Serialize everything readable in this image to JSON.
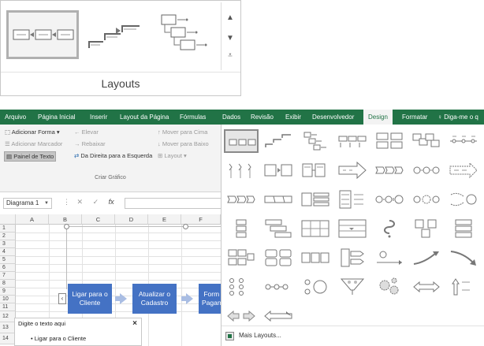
{
  "zoom_gallery": {
    "label": "Layouts",
    "scroll_up": "▲",
    "scroll_down": "▼",
    "scroll_more": "⩡"
  },
  "tabs": [
    "Arquivo",
    "Página Inicial",
    "Inserir",
    "Layout da Página",
    "Fórmulas",
    "Dados",
    "Revisão",
    "Exibir",
    "Desenvolvedor",
    "Design",
    "Formatar",
    "Diga-me o q"
  ],
  "tell_me_icon": "lightbulb-icon",
  "ribbon": {
    "add_shape": "Adicionar Forma",
    "add_bullet": "Adicionar Marcador",
    "text_pane": "Painel de Texto",
    "promote": "Elevar",
    "demote": "Rebaixar",
    "right_to_left": "Da Direita para a Esquerda",
    "move_up": "Mover para Cima",
    "move_down": "Mover para Baixo",
    "layout": "Layout",
    "group_label": "Criar Gráfico"
  },
  "formula_bar": {
    "name_box": "Diagrama 1",
    "cancel": "✕",
    "enter": "✓",
    "fx": "fx",
    "value": ""
  },
  "grid": {
    "columns": [
      "A",
      "B",
      "C",
      "D",
      "E",
      "F"
    ],
    "rows": [
      "1",
      "2",
      "3",
      "4",
      "5",
      "6",
      "7",
      "8",
      "9",
      "10",
      "11",
      "12",
      "13",
      "14"
    ]
  },
  "smartart": {
    "nodes": [
      "Ligar para o Cliente",
      "Atualizar o Cadastro",
      "Form Pagan"
    ],
    "node_color": "#4472c4",
    "arrow_color": "#a9bde3",
    "pane_toggle": "‹"
  },
  "text_pane": {
    "title": "Digite o texto aqui",
    "close": "×",
    "items": [
      "Ligar para o Cliente"
    ]
  },
  "gallery": {
    "more_layouts": "Mais Layouts..."
  },
  "colors": {
    "ribbon_green": "#217346",
    "accent_blue": "#4472c4"
  }
}
